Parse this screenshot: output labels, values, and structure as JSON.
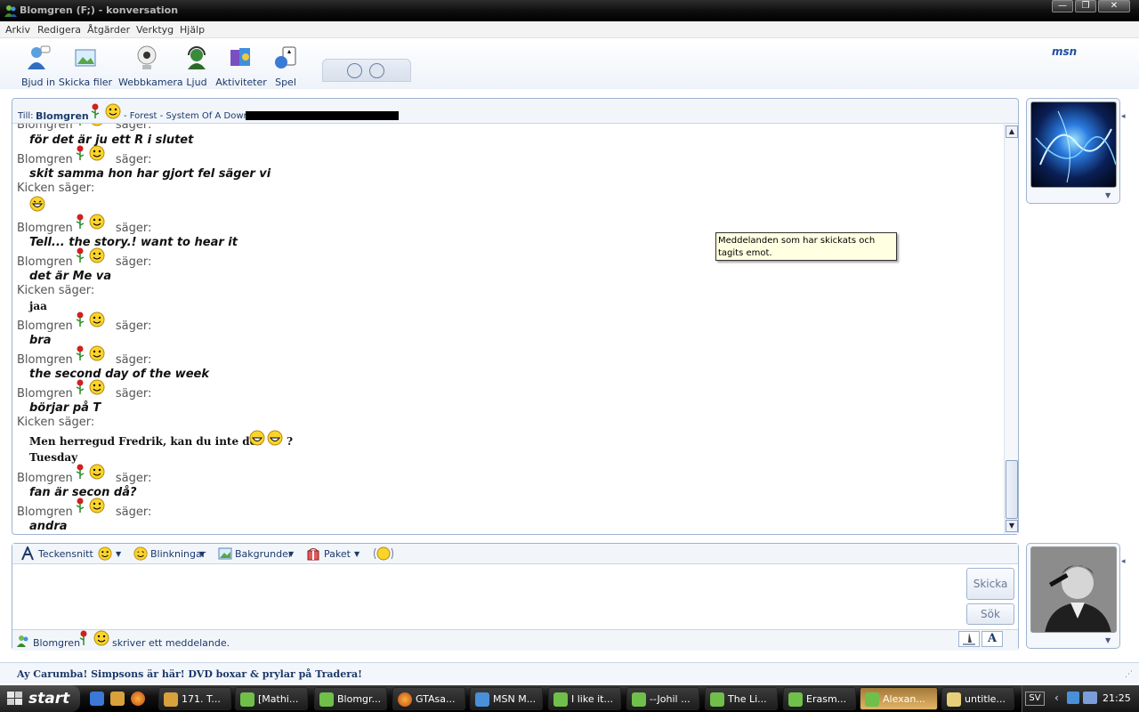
{
  "window": {
    "title": "Blomgren (F;) - konversation",
    "buttons": {
      "minimize": "—",
      "maximize": "❐",
      "close": "✕"
    }
  },
  "menu": [
    "Arkiv",
    "Redigera",
    "Åtgärder",
    "Verktyg",
    "Hjälp"
  ],
  "toolbar": {
    "items": [
      "Bjud in",
      "Skicka filer",
      "Webbkamera",
      "Ljud",
      "Aktiviteter",
      "Spel"
    ],
    "logo": "msn"
  },
  "header": {
    "to_label": "Till:",
    "contact": "Blomgren",
    "song": "- Forest - System Of A Down"
  },
  "chat": {
    "says": "säger:",
    "entries": [
      {
        "sender": "Blomgren",
        "text": "för det är ju ett R i slutet"
      },
      {
        "sender": "Blomgren",
        "text": "skit samma hon har gjort fel säger vi"
      },
      {
        "sender": "Kicken",
        "text": ""
      },
      {
        "sender": "Blomgren",
        "text": "Tell... the story.! want to hear it"
      },
      {
        "sender": "Blomgren",
        "text": "det är Me va"
      },
      {
        "sender": "Kicken",
        "text": "jaa"
      },
      {
        "sender": "Blomgren",
        "text": "bra"
      },
      {
        "sender": "Blomgren",
        "text": "the second day of the week"
      },
      {
        "sender": "Blomgren",
        "text": "börjar på T"
      },
      {
        "sender": "Kicken",
        "text": "Men herregud Fredrik, kan du inte det",
        "text_suffix": "?",
        "text2": "Tuesday"
      },
      {
        "sender": "Blomgren",
        "text": "fan är secon då?"
      },
      {
        "sender": "Blomgren",
        "text": "andra"
      }
    ]
  },
  "tooltip": "Meddelanden som har skickats och tagits emot.",
  "format_bar": {
    "font": "Teckensnitt",
    "winks": "Blinkningar",
    "backgrounds": "Bakgrunder",
    "packages": "Paket"
  },
  "input": {
    "value": "",
    "send": "Skicka",
    "search": "Sök"
  },
  "status": {
    "name": "Blomgren",
    "typing": "skriver ett meddelande."
  },
  "ad": "Ay Carumba! Simpsons är här! DVD boxar & prylar på Tradera!",
  "taskbar": {
    "start": "start",
    "tasks": [
      "171. T...",
      "[Mathi...",
      "Blomgr...",
      "GTAsa...",
      "MSN M...",
      "I like it...",
      "--Johil ...",
      "The Li...",
      "Erasm...",
      "Alexan...",
      "untitle..."
    ],
    "active_task": "Alexan...",
    "language": "SV",
    "clock": "21:25"
  },
  "colors": {
    "accent": "#1c3a6a",
    "border": "#9fb3d1",
    "tooltip_bg": "#ffffe1"
  }
}
